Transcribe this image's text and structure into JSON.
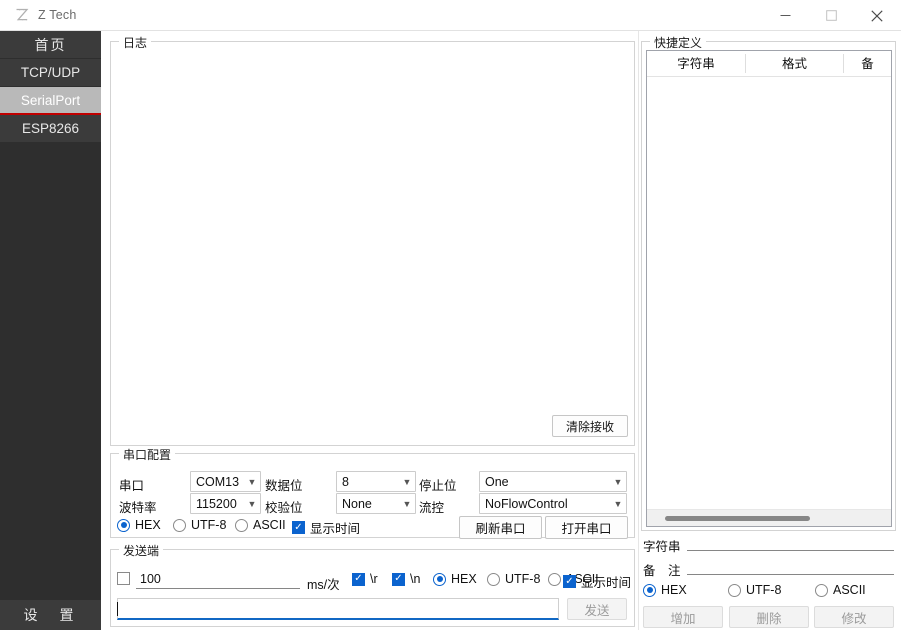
{
  "window": {
    "title": "Z Tech",
    "logo_icon": "z-logo-icon",
    "controls": {
      "minimize": "—",
      "maximize": "□",
      "close": "✕"
    }
  },
  "sidebar": {
    "items": [
      {
        "label": "首页",
        "active": false
      },
      {
        "label": "TCP/UDP",
        "active": false
      },
      {
        "label": "SerialPort",
        "active": true
      },
      {
        "label": "ESP8266",
        "active": false
      }
    ],
    "settings_label": "设　置"
  },
  "log_panel": {
    "title": "日志",
    "content": "",
    "clear_button": "清除接收"
  },
  "serial_config": {
    "title": "串口配置",
    "fields": {
      "port_label": "串口",
      "port_value": "COM13",
      "databits_label": "数据位",
      "databits_value": "8",
      "stopbits_label": "停止位",
      "stopbits_value": "One",
      "baud_label": "波特率",
      "baud_value": "115200",
      "parity_label": "校验位",
      "parity_value": "None",
      "flow_label": "流控",
      "flow_value": "NoFlowControl"
    },
    "encoding": {
      "hex": "HEX",
      "utf8": "UTF-8",
      "ascii": "ASCII",
      "selected": "HEX"
    },
    "show_time_label": "显示时间",
    "show_time_checked": true,
    "refresh_button": "刷新串口",
    "open_button": "打开串口"
  },
  "send_panel": {
    "title": "发送端",
    "interval_checked": false,
    "interval_value": "100",
    "interval_unit": "ms/次",
    "cr_label": "\\r",
    "cr_checked": true,
    "lf_label": "\\n",
    "lf_checked": true,
    "encoding": {
      "hex": "HEX",
      "utf8": "UTF-8",
      "ascii": "ASCII",
      "selected": "HEX"
    },
    "show_time_label": "显示时间",
    "show_time_checked": true,
    "message_value": "",
    "send_button": "发送",
    "send_button_enabled": false
  },
  "quick_define": {
    "title": "快捷定义",
    "columns": [
      {
        "label": "字符串"
      },
      {
        "label": "格式"
      },
      {
        "label": "备"
      }
    ],
    "rows": [],
    "string_label": "字符串",
    "string_value": "",
    "note_label": "备　注",
    "note_value": "",
    "encoding": {
      "hex": "HEX",
      "utf8": "UTF-8",
      "ascii": "ASCII",
      "selected": "HEX"
    },
    "add_button": "增加",
    "delete_button": "删除",
    "modify_button": "修改"
  },
  "colors": {
    "accent": "#0b63ce",
    "sidebar_bg": "#2e2e2e",
    "sidebar_item_bg": "#3b3b3b",
    "sidebar_active_bg": "#b9b9b9",
    "sidebar_active_underline": "#c00000"
  }
}
